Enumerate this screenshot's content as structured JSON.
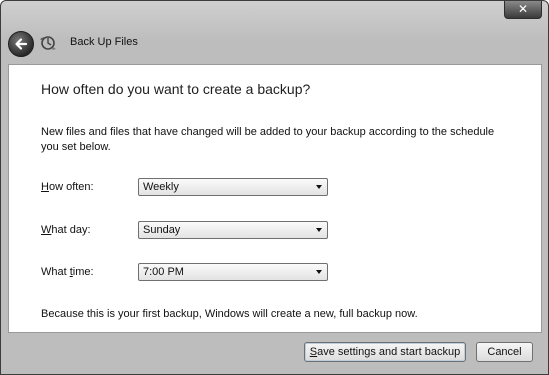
{
  "window": {
    "title": "Back Up Files",
    "close_glyph": "✕"
  },
  "content": {
    "heading": "How often do you want to create a backup?",
    "description": "New files and files that have changed will be added to your backup according to the schedule you set below.",
    "fields": {
      "how_often": {
        "label_accel": "H",
        "label_rest": "ow often:",
        "value": "Weekly"
      },
      "what_day": {
        "label_accel": "W",
        "label_rest": "hat day:",
        "value": "Sunday"
      },
      "what_time": {
        "label_pre": "What ",
        "label_accel": "t",
        "label_rest": "ime:",
        "value": "7:00 PM"
      }
    },
    "note": "Because this is your first backup, Windows will create a new, full backup now."
  },
  "footer": {
    "save_accel": "S",
    "save_rest": "ave settings and start backup",
    "cancel_label": "Cancel"
  },
  "icons": {
    "back": "back-arrow-icon",
    "app": "backup-icon",
    "close": "close-icon",
    "dropdown": "chevron-down-icon"
  }
}
